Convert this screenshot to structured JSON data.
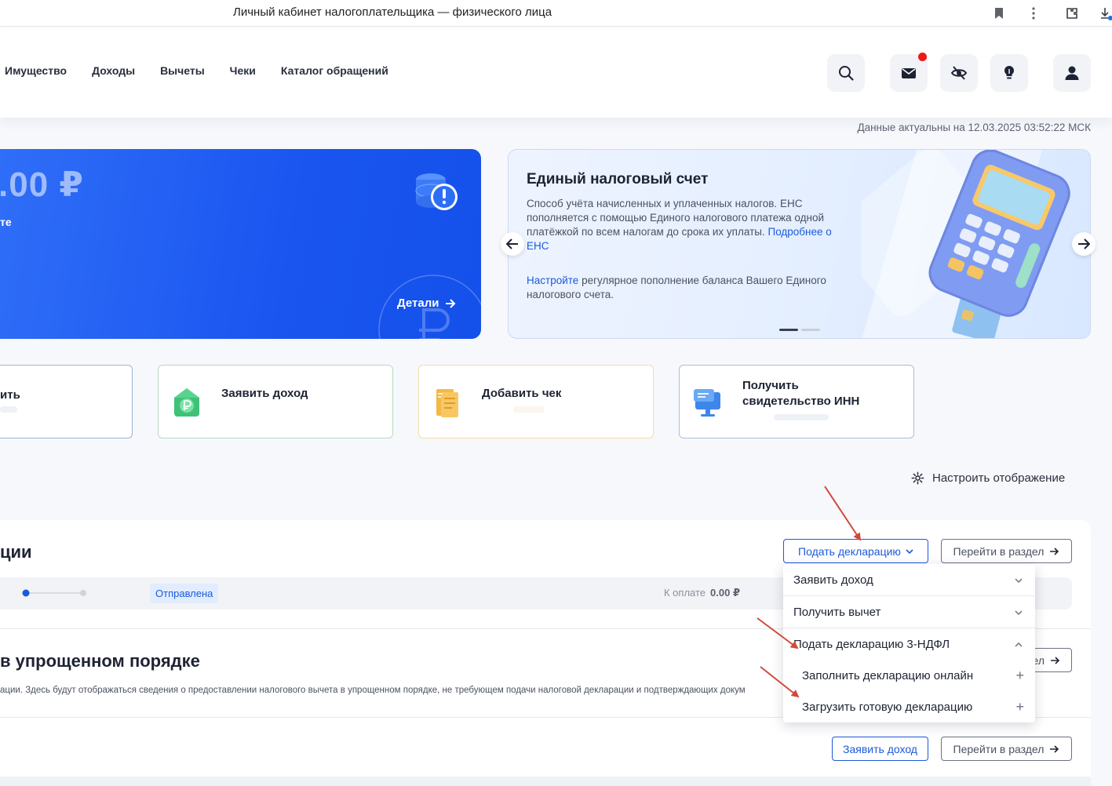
{
  "browser": {
    "title": "Личный кабинет налогоплательщика — физического лица"
  },
  "nav": {
    "items": [
      {
        "label": "Имущество"
      },
      {
        "label": "Доходы"
      },
      {
        "label": "Вычеты"
      },
      {
        "label": "Чеки"
      },
      {
        "label": "Каталог обращений"
      }
    ]
  },
  "header_icons": [
    "search-icon",
    "mail-icon",
    "hide-eye-icon",
    "lightbulb-icon",
    "user-icon"
  ],
  "actual_date": "Данные актуальны на 12.03.2025 03:52:22 МСК",
  "balance_card": {
    "amount": ".00 ₽",
    "subtitle": "те",
    "details_label": "Детали"
  },
  "ens_card": {
    "title": "Единый налоговый счет",
    "text": "Способ учёта начисленных и уплаченных налогов. ЕНС пополняется с помощью Единого налогового платежа одной платёжкой по всем налогам до срока их уплаты.",
    "text_link": "Подробнее о ЕНС",
    "text2_link": "Настройте",
    "text2": "регулярное пополнение баланса Вашего Единого налогового счета."
  },
  "quick_actions": [
    {
      "label": "ить"
    },
    {
      "label": "Заявить доход"
    },
    {
      "label": "Добавить чек"
    },
    {
      "label": "Получить свидетельство ИНН"
    }
  ],
  "settings_label": "Настроить отображение",
  "declarations": {
    "title": "ции",
    "submit_label": "Подать декларацию",
    "goto_label": "Перейти в раздел",
    "status": "Отправлена",
    "due_label": "К оплате",
    "due_value": "0.00 ₽"
  },
  "simplified": {
    "title": "в упрощенном порядке",
    "goto_label_partial": "ел",
    "description": "ации. Здесь будут отображаться сведения о предоставлении налогового вычета в упрощенном порядке, не требующем подачи налоговой декларации и подтверждающих докум"
  },
  "income": {
    "claim_label": "Заявить доход",
    "goto_label": "Перейти в раздел"
  },
  "dropdown": {
    "items": [
      {
        "label": "Заявить доход"
      },
      {
        "label": "Получить вычет"
      },
      {
        "label": "Подать декларацию 3-НДФЛ"
      }
    ],
    "subitems": [
      {
        "label": "Заполнить декларацию онлайн"
      },
      {
        "label": "Загрузить готовую декларацию"
      }
    ]
  },
  "colors": {
    "accent": "#1c5ad9",
    "balance_card": "#1a55f0",
    "annotation_arrow": "#d2483b"
  }
}
